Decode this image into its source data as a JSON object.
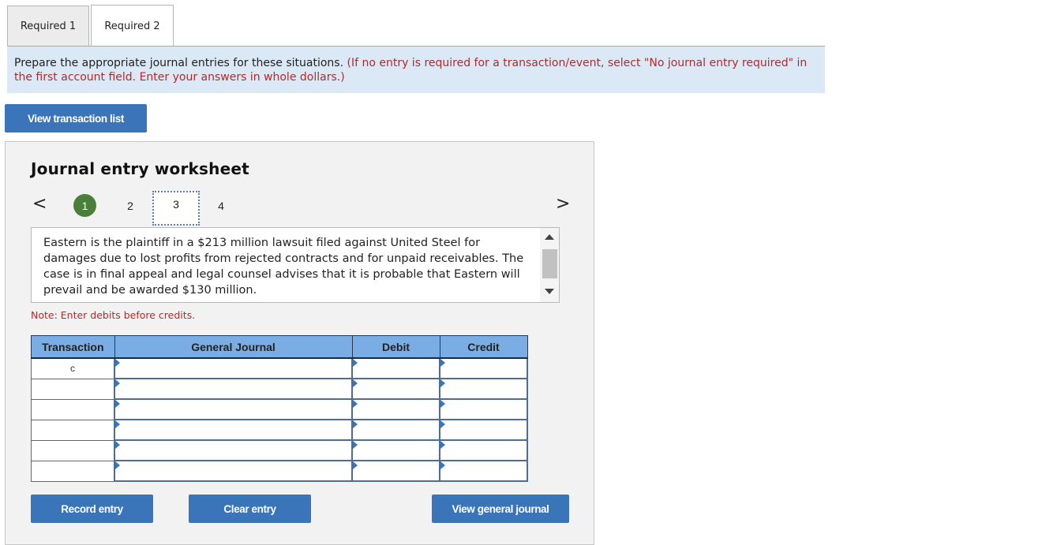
{
  "tabs": [
    {
      "label": "Required 1",
      "active": false
    },
    {
      "label": "Required 2",
      "active": true
    }
  ],
  "instructions": {
    "main": "Prepare the appropriate journal entries for these situations.",
    "note": "(If no entry is required for a transaction/event, select \"No journal entry required\" in the first account field. Enter your answers in whole dollars.)"
  },
  "view_transaction_list_label": "View transaction list",
  "worksheet": {
    "title": "Journal entry worksheet",
    "prev_icon": "<",
    "next_icon": ">",
    "steps": [
      {
        "label": "1",
        "state": "completed"
      },
      {
        "label": "2",
        "state": "default"
      },
      {
        "label": "3",
        "state": "current"
      },
      {
        "label": "4",
        "state": "default"
      }
    ],
    "description": "Eastern is the plaintiff in a $213 million lawsuit filed against United Steel for damages due to lost profits from rejected contracts and for unpaid receivables. The case is in final appeal and legal counsel advises that it is probable that Eastern will prevail and be awarded $130 million.",
    "note": "Note: Enter debits before credits.",
    "table": {
      "headers": [
        "Transaction",
        "General Journal",
        "Debit",
        "Credit"
      ],
      "rows": [
        {
          "transaction": "c",
          "account": "",
          "debit": "",
          "credit": ""
        },
        {
          "transaction": "",
          "account": "",
          "debit": "",
          "credit": ""
        },
        {
          "transaction": "",
          "account": "",
          "debit": "",
          "credit": ""
        },
        {
          "transaction": "",
          "account": "",
          "debit": "",
          "credit": ""
        },
        {
          "transaction": "",
          "account": "",
          "debit": "",
          "credit": ""
        },
        {
          "transaction": "",
          "account": "",
          "debit": "",
          "credit": ""
        }
      ]
    },
    "buttons": {
      "record": "Record entry",
      "clear": "Clear entry",
      "view_journal": "View general journal"
    }
  },
  "colors": {
    "button_blue": "#3a75ba",
    "instruction_bg": "#dbe9f6",
    "red_text": "#b22a2a",
    "header_blue": "#79ade4",
    "completed_green": "#4a7f3a"
  }
}
